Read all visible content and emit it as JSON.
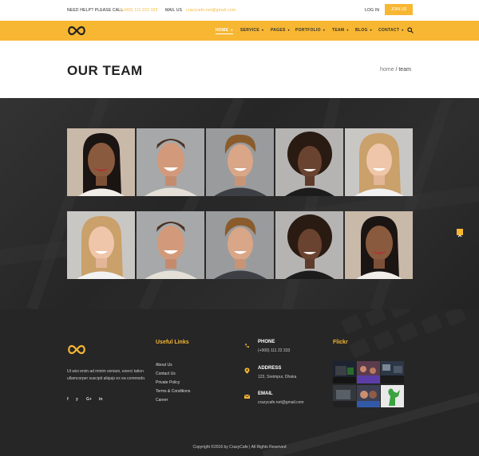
{
  "topbar": {
    "help_label": "NEED HELP? PLEASE CALL",
    "help_phone": "(+000) 111 222 333",
    "mail_label": "MAIL US",
    "mail_value": "crazycafe.net@gmail.com",
    "login": "LOG IN",
    "join": "JOIN US"
  },
  "nav": {
    "items": [
      {
        "label": "HOME",
        "active": true
      },
      {
        "label": "SERVICE"
      },
      {
        "label": "PAGES"
      },
      {
        "label": "PORTFOLIO"
      },
      {
        "label": "TEAM"
      },
      {
        "label": "BLOG"
      },
      {
        "label": "CONTACT"
      }
    ]
  },
  "page": {
    "title": "OUR TEAM",
    "crumb_home": "home",
    "crumb_current": "/ team"
  },
  "footer": {
    "about": "Ut wisi enim ad minim veniam, exerci tation ullamcorper suscipit aliquip ex ea commodo.",
    "social": [
      "f",
      "y",
      "G+",
      "in"
    ],
    "useful_links_heading": "Useful Links",
    "links": [
      "About Us",
      "Contact Us",
      "Private Policy",
      "Terms & Conditions",
      "Career"
    ],
    "contact": {
      "phone_label": "PHONE",
      "phone_value": "(+000) 111 22 333",
      "address_label": "ADDRESS",
      "address_value": "123, Sreimpur, Dhaka",
      "email_label": "EMAIL",
      "email_value": "crazycafe.net@gmail.com"
    },
    "flickr_heading": "Flickr",
    "copyright": "Copyright ©2016 by CrazyCafe   |   All Rights Reserved"
  },
  "colors": {
    "accent": "#f7b733",
    "dark": "#262626"
  }
}
